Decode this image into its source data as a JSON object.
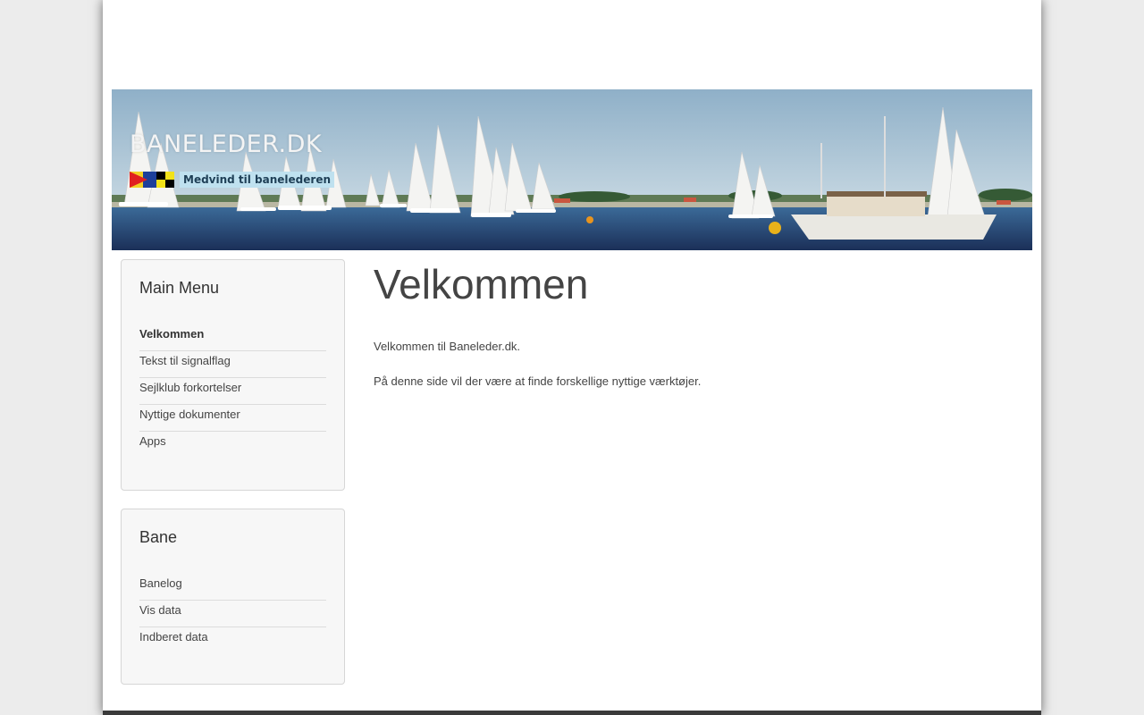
{
  "banner": {
    "title": "BANELEDER.DK",
    "tagline": "Medvind til banelederen"
  },
  "sidebar": {
    "main_menu": {
      "title": "Main Menu",
      "items": [
        {
          "label": "Velkommen",
          "active": true
        },
        {
          "label": "Tekst til signalflag"
        },
        {
          "label": "Sejlklub forkortelser"
        },
        {
          "label": "Nyttige dokumenter"
        },
        {
          "label": "Apps"
        }
      ]
    },
    "bane_menu": {
      "title": "Bane",
      "items": [
        {
          "label": "Banelog"
        },
        {
          "label": "Vis data"
        },
        {
          "label": "Indberet data"
        }
      ]
    }
  },
  "content": {
    "heading": "Velkommen",
    "paragraphs": [
      "Velkommen til Baneleder.dk.",
      "På denne side vil der være at finde forskellige nyttige værktøjer."
    ]
  }
}
